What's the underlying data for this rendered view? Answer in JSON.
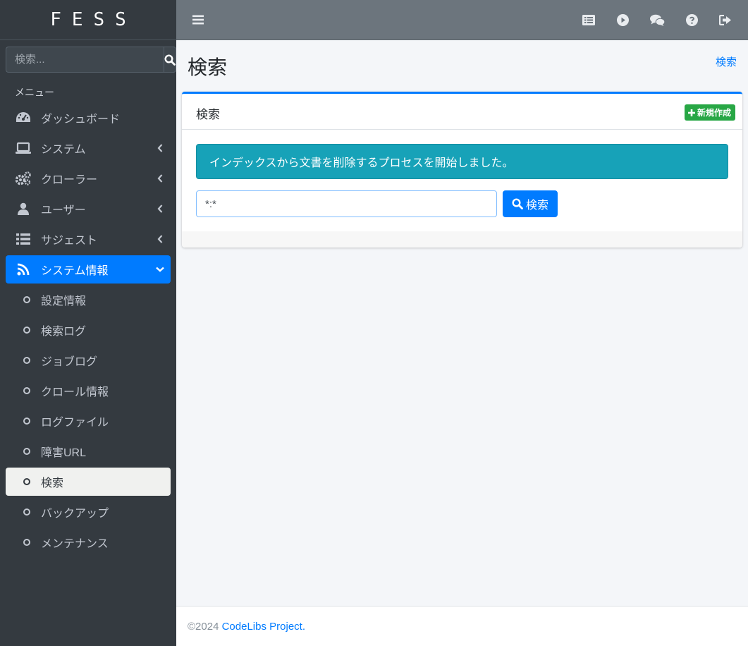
{
  "brand": "FESS",
  "sidebar": {
    "search_placeholder": "検索...",
    "menu_header": "メニュー",
    "items": [
      {
        "label": "ダッシュボード",
        "icon": "dashboard-icon"
      },
      {
        "label": "システム",
        "icon": "laptop-icon"
      },
      {
        "label": "クローラー",
        "icon": "cogs-icon"
      },
      {
        "label": "ユーザー",
        "icon": "user-icon"
      },
      {
        "label": "サジェスト",
        "icon": "list-icon"
      },
      {
        "label": "システム情報",
        "icon": "rss-icon"
      }
    ],
    "subitems": [
      {
        "label": "設定情報"
      },
      {
        "label": "検索ログ"
      },
      {
        "label": "ジョブログ"
      },
      {
        "label": "クロール情報"
      },
      {
        "label": "ログファイル"
      },
      {
        "label": "障害URL"
      },
      {
        "label": "検索"
      },
      {
        "label": "バックアップ"
      },
      {
        "label": "メンテナンス"
      }
    ]
  },
  "header": {
    "page_title": "検索",
    "breadcrumb": "検索"
  },
  "card": {
    "title": "検索",
    "new_button": "新規作成",
    "alert": "インデックスから文書を削除するプロセスを開始しました。",
    "query_value": "*:*",
    "search_button": "検索"
  },
  "footer": {
    "copyright": "©2024",
    "link": "CodeLibs Project."
  },
  "colors": {
    "sidebar_bg": "#343a40",
    "navbar_bg": "#6c757d",
    "primary": "#007bff",
    "success": "#28a745",
    "info": "#17a2b8"
  }
}
